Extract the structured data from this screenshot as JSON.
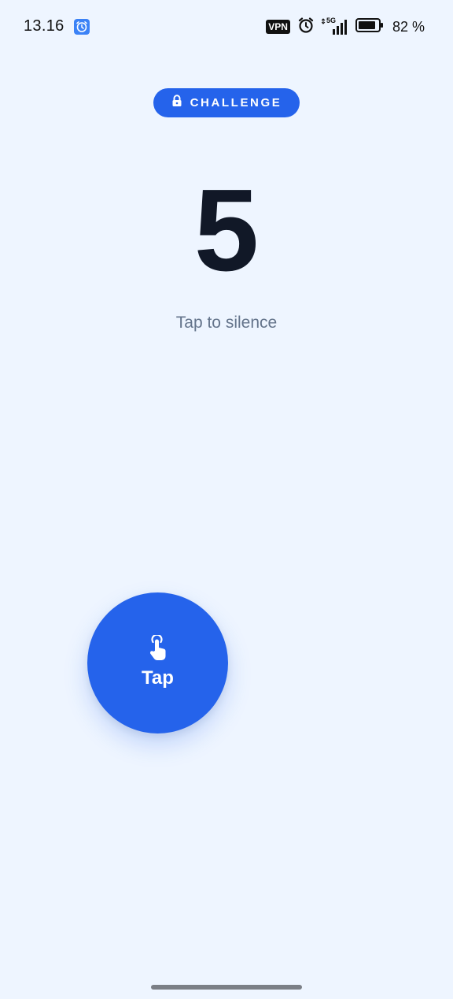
{
  "status_bar": {
    "time": "13.16",
    "vpn_label": "VPN",
    "network": "5G",
    "battery": "82 %",
    "icons": [
      "alarm-app-icon",
      "alarm-clock-icon",
      "signal-icon",
      "battery-icon"
    ]
  },
  "challenge": {
    "label": "CHALLENGE",
    "icon": "lock-icon"
  },
  "counter": {
    "value": "5",
    "subtitle": "Tap to silence"
  },
  "tap_button": {
    "label": "Tap",
    "icon": "tap-finger-icon"
  },
  "colors": {
    "background": "#EEF5FF",
    "accent": "#2563EB",
    "count_text": "#111827",
    "subtitle_text": "#64748B"
  }
}
